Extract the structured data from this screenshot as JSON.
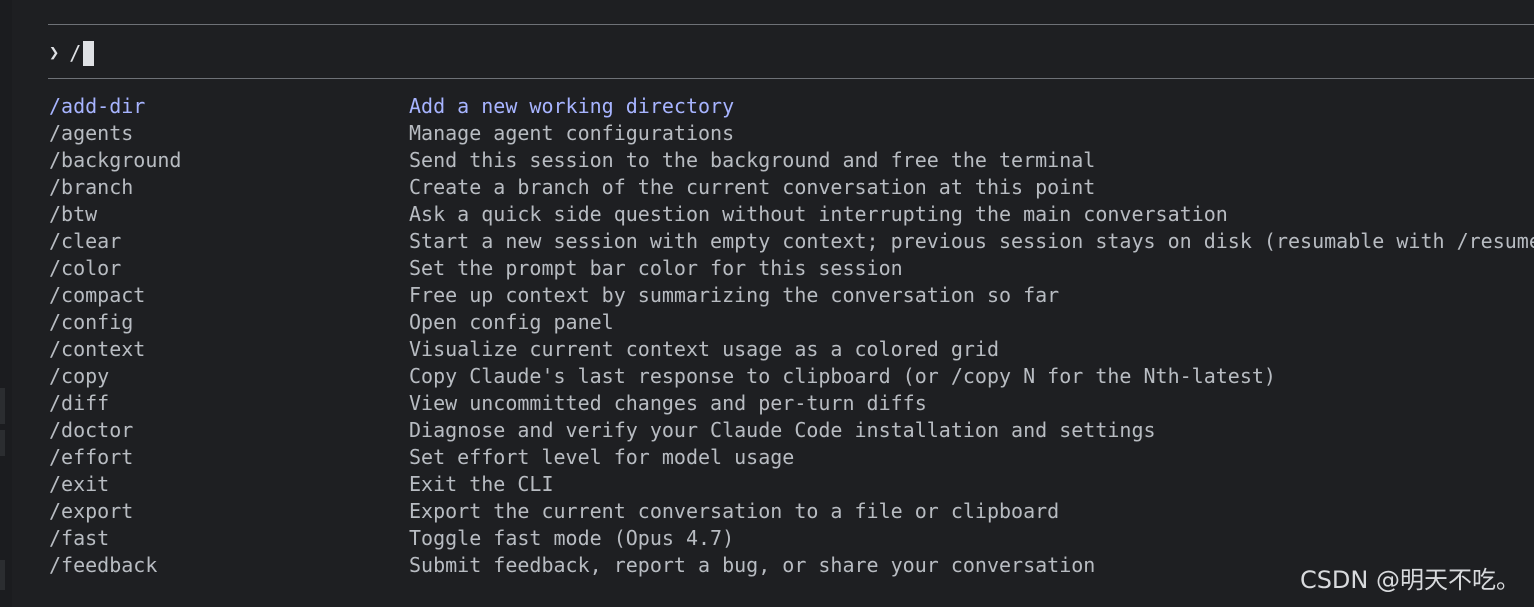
{
  "prompt": {
    "symbol": "❯",
    "input_value": "/"
  },
  "commands": [
    {
      "name": "/add-dir",
      "description": "Add a new working directory",
      "selected": true
    },
    {
      "name": "/agents",
      "description": "Manage agent configurations"
    },
    {
      "name": "/background",
      "description": "Send this session to the background and free the terminal"
    },
    {
      "name": "/branch",
      "description": "Create a branch of the current conversation at this point"
    },
    {
      "name": "/btw",
      "description": "Ask a quick side question without interrupting the main conversation"
    },
    {
      "name": "/clear",
      "description": "Start a new session with empty context; previous session stays on disk (resumable with /resume"
    },
    {
      "name": "/color",
      "description": "Set the prompt bar color for this session"
    },
    {
      "name": "/compact",
      "description": "Free up context by summarizing the conversation so far"
    },
    {
      "name": "/config",
      "description": "Open config panel"
    },
    {
      "name": "/context",
      "description": "Visualize current context usage as a colored grid"
    },
    {
      "name": "/copy",
      "description": "Copy Claude's last response to clipboard (or /copy N for the Nth-latest)"
    },
    {
      "name": "/diff",
      "description": "View uncommitted changes and per-turn diffs"
    },
    {
      "name": "/doctor",
      "description": "Diagnose and verify your Claude Code installation and settings"
    },
    {
      "name": "/effort",
      "description": "Set effort level for model usage"
    },
    {
      "name": "/exit",
      "description": "Exit the CLI"
    },
    {
      "name": "/export",
      "description": "Export the current conversation to a file or clipboard"
    },
    {
      "name": "/fast",
      "description": "Toggle fast mode (Opus 4.7)"
    },
    {
      "name": "/feedback",
      "description": "Submit feedback, report a bug, or share your conversation"
    }
  ],
  "watermark": "CSDN @明天不吃。",
  "colors": {
    "background": "#1e1f22",
    "text": "#b8bcc2",
    "selected": "#a7b4ff",
    "rule": "#6e7177"
  }
}
